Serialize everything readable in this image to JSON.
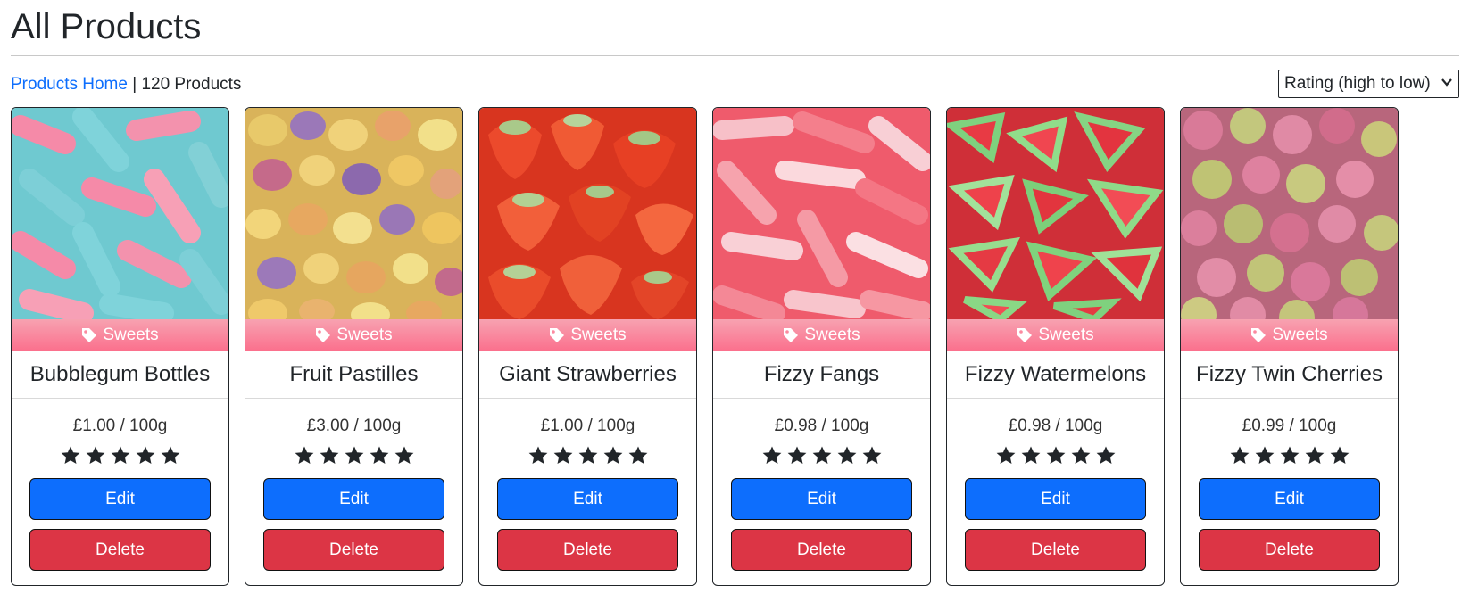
{
  "page": {
    "title": "All Products"
  },
  "toolbar": {
    "home_link": "Products Home",
    "separator": "|",
    "count": "120 Products",
    "sort_selected": "Rating (high to low)"
  },
  "colors": {
    "primary": "#0d6efd",
    "danger": "#dc3545",
    "tag": "#fb6f8c"
  },
  "products": [
    {
      "category": "Sweets",
      "name": "Bubblegum Bottles",
      "price": "£1.00 / 100g",
      "rating": 5,
      "edit": "Edit",
      "delete": "Delete"
    },
    {
      "category": "Sweets",
      "name": "Fruit Pastilles",
      "price": "£3.00 / 100g",
      "rating": 5,
      "edit": "Edit",
      "delete": "Delete"
    },
    {
      "category": "Sweets",
      "name": "Giant Strawberries",
      "price": "£1.00 / 100g",
      "rating": 5,
      "edit": "Edit",
      "delete": "Delete"
    },
    {
      "category": "Sweets",
      "name": "Fizzy Fangs",
      "price": "£0.98 / 100g",
      "rating": 5,
      "edit": "Edit",
      "delete": "Delete"
    },
    {
      "category": "Sweets",
      "name": "Fizzy Watermelons",
      "price": "£0.98 / 100g",
      "rating": 5,
      "edit": "Edit",
      "delete": "Delete"
    },
    {
      "category": "Sweets",
      "name": "Fizzy Twin Cherries",
      "price": "£0.99 / 100g",
      "rating": 5,
      "edit": "Edit",
      "delete": "Delete"
    }
  ]
}
